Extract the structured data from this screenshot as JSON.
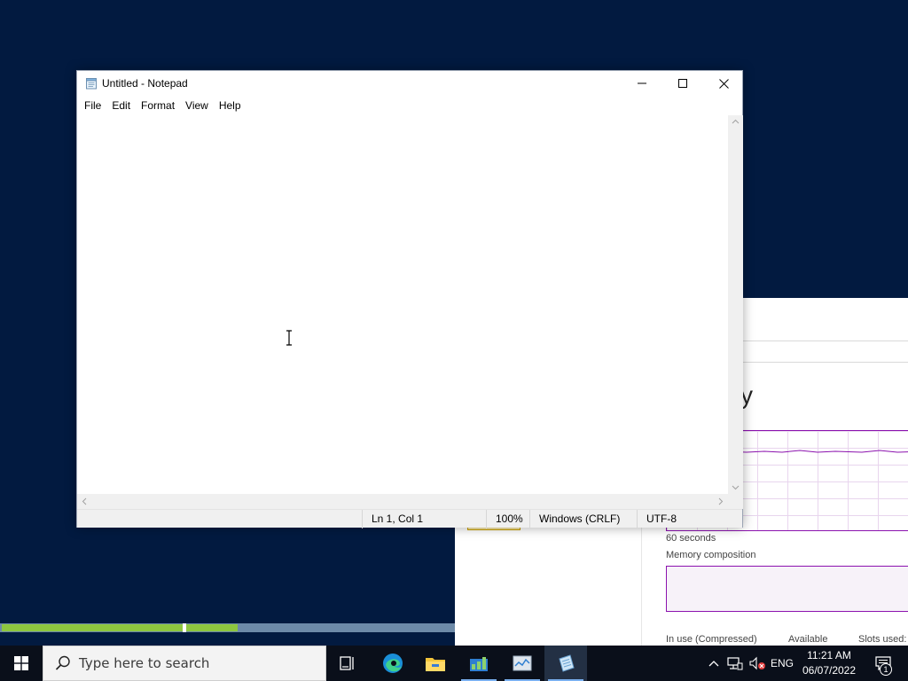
{
  "notepad": {
    "title": "Untitled - Notepad",
    "menu": [
      "File",
      "Edit",
      "Format",
      "View",
      "Help"
    ],
    "content": "",
    "status": {
      "position": "Ln 1, Col 1",
      "zoom": "100%",
      "line_ending": "Windows (CRLF)",
      "encoding": "UTF-8"
    }
  },
  "taskmgr": {
    "title_fragment": "y",
    "graph_label": "60 seconds",
    "memory_composition": "Memory composition",
    "in_use": "In use (Compressed)",
    "available": "Available",
    "slots": "Slots used:"
  },
  "taskbar": {
    "search_placeholder": "Type here to search",
    "apps": [
      "task-view",
      "edge",
      "file-explorer",
      "server-manager",
      "task-manager",
      "notepad"
    ],
    "active_app": "notepad",
    "language": "ENG",
    "time": "11:21 AM",
    "date": "06/07/2022",
    "notification_count": "1"
  },
  "colors": {
    "desktop": "#021a40",
    "taskbar": "#0a0f1a",
    "memory_graph": "#8b12ae",
    "progress_green": "#8ec63f"
  }
}
